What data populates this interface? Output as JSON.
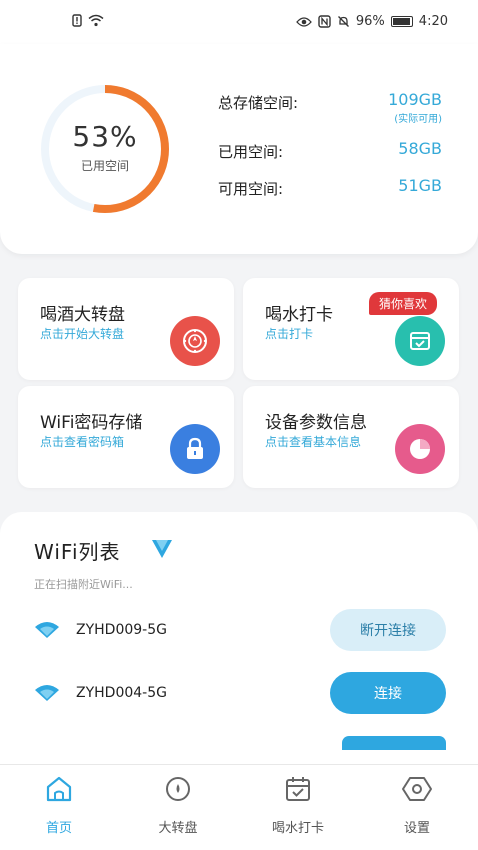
{
  "status_bar": {
    "battery": "96%",
    "time": "4:20"
  },
  "storage": {
    "percent": "53%",
    "percent_label": "已用空间",
    "used_fraction": 0.53,
    "total_label": "总存储空间:",
    "total_value": "109GB",
    "total_note": "(实际可用)",
    "used_label": "已用空间:",
    "used_value": "58GB",
    "free_label": "可用空间:",
    "free_value": "51GB"
  },
  "features": [
    {
      "title": "喝酒大转盘",
      "subtitle": "点击开始大转盘",
      "icon": "wheel-icon",
      "icon_color": "#e8524a"
    },
    {
      "title": "喝水打卡",
      "subtitle": "点击打卡",
      "badge": "猜你喜欢",
      "icon": "calendar-check-icon",
      "icon_color": "#28bfae"
    },
    {
      "title": "WiFi密码存储",
      "subtitle": "点击查看密码箱",
      "icon": "lock-icon",
      "icon_color": "#3a7fe0"
    },
    {
      "title": "设备参数信息",
      "subtitle": "点击查看基本信息",
      "icon": "pie-icon",
      "icon_color": "#e65b8c"
    }
  ],
  "wifi": {
    "title": "WiFi列表",
    "scanning": "正在扫描附近WiFi...",
    "networks": [
      {
        "name": "ZYHD009-5G",
        "action": "断开连接"
      },
      {
        "name": "ZYHD004-5G",
        "action": "连接"
      }
    ]
  },
  "nav": [
    {
      "label": "首页",
      "icon": "home-icon",
      "active": true
    },
    {
      "label": "大转盘",
      "icon": "wheel-icon",
      "active": false
    },
    {
      "label": "喝水打卡",
      "icon": "calendar-icon",
      "active": false
    },
    {
      "label": "设置",
      "icon": "settings-icon",
      "active": false
    }
  ],
  "colors": {
    "accent": "#2ea7e0",
    "ring": "#f07a2f",
    "badge": "#e0383b"
  }
}
